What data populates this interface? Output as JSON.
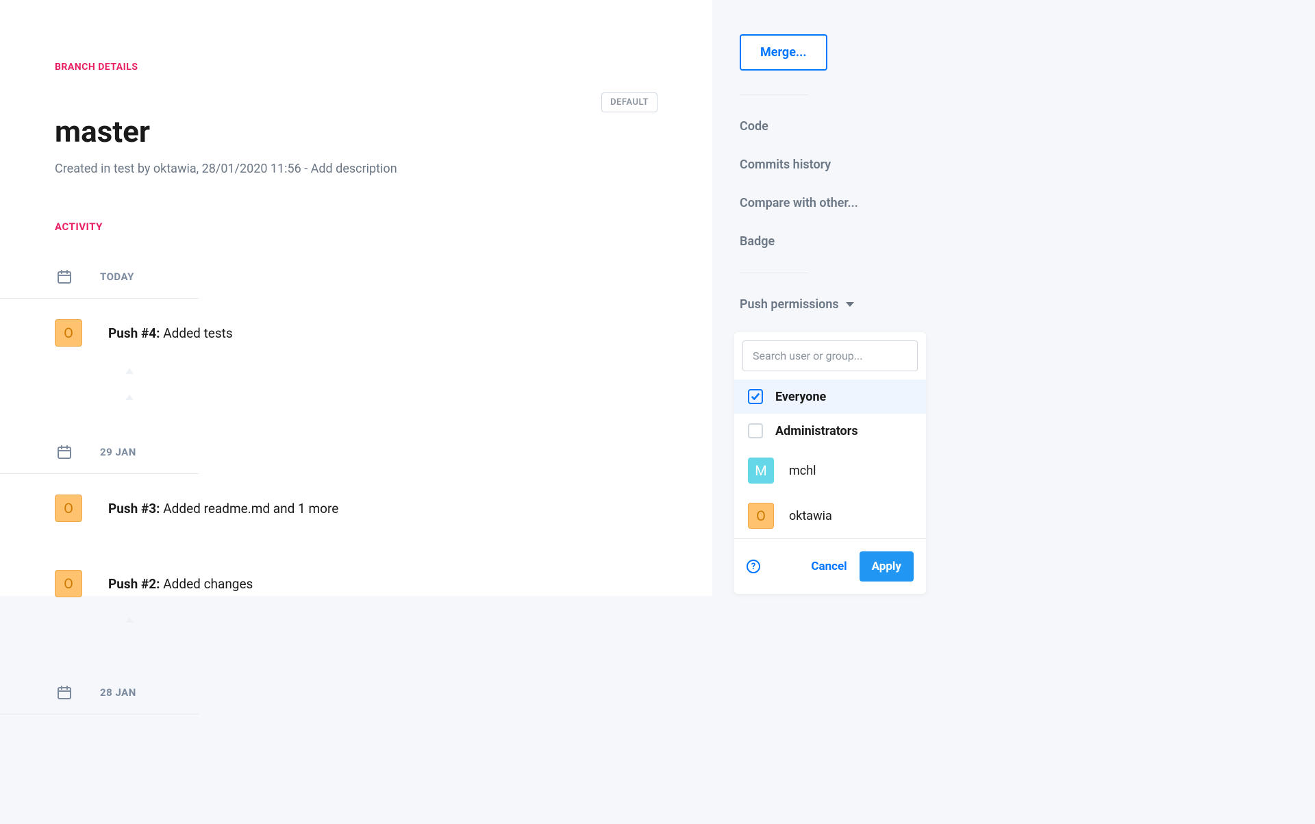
{
  "header": {
    "section_label": "BRANCH DETAILS",
    "branch_name": "master",
    "default_badge": "DEFAULT",
    "meta_prefix": "Created in test by ",
    "meta_user": "oktawia",
    "meta_date": ", 28/01/2020 11:56",
    "meta_sep": " - ",
    "meta_add_desc": "Add description"
  },
  "activity": {
    "label": "ACTIVITY",
    "groups": [
      {
        "date_label": "TODAY",
        "items": [
          {
            "avatar_letter": "O",
            "avatar_color": "orange",
            "push_label": "Push #4:",
            "message": " Added tests"
          }
        ],
        "trailing_arrows": 2
      },
      {
        "date_label": "29 JAN",
        "items": [
          {
            "avatar_letter": "O",
            "avatar_color": "orange",
            "push_label": "Push #3:",
            "message": " Added readme.md and 1 more"
          },
          {
            "avatar_letter": "O",
            "avatar_color": "orange",
            "push_label": "Push #2:",
            "message": " Added changes"
          }
        ],
        "trailing_arrows": 1
      },
      {
        "date_label": "28 JAN",
        "items": [],
        "trailing_arrows": 0
      }
    ]
  },
  "sidebar": {
    "merge_button": "Merge...",
    "links": [
      "Code",
      "Commits history",
      "Compare with other...",
      "Badge"
    ],
    "push_permissions_label": "Push permissions"
  },
  "permissions_panel": {
    "search_placeholder": "Search user or group...",
    "groups": [
      {
        "label": "Everyone",
        "checked": true
      },
      {
        "label": "Administrators",
        "checked": false
      }
    ],
    "users": [
      {
        "label": "mchl",
        "avatar_letter": "M",
        "avatar_color": "cyan"
      },
      {
        "label": "oktawia",
        "avatar_letter": "O",
        "avatar_color": "orange"
      }
    ],
    "help_char": "?",
    "cancel_label": "Cancel",
    "apply_label": "Apply"
  }
}
